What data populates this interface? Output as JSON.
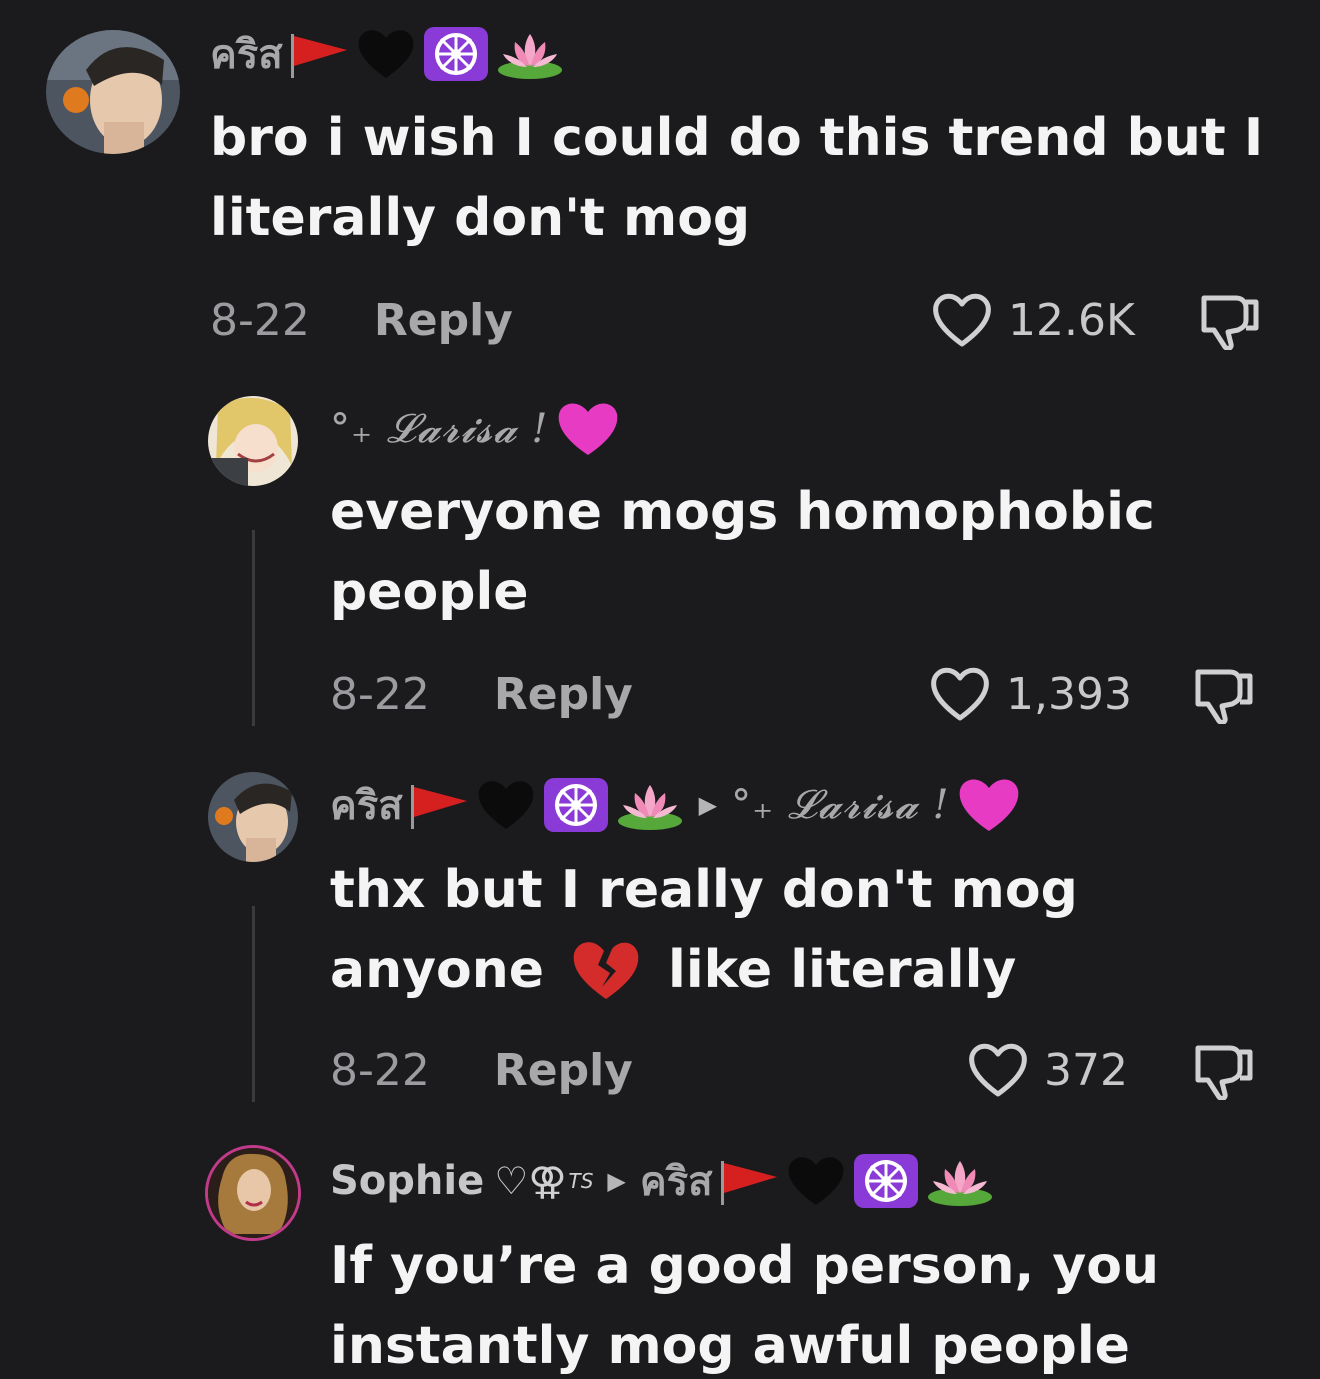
{
  "colors": {
    "background": "#1b1b1d",
    "text": "#f4f4f4",
    "muted": "#9c9ca0",
    "heart_pink": "#e83bc4",
    "wheel_purple": "#8a3ad6",
    "flag_red": "#d61f1f"
  },
  "icons": [
    "heart-outline-icon",
    "thumbs-down-icon",
    "red-flag-icon",
    "black-heart-icon",
    "dharma-wheel-icon",
    "lotus-icon",
    "pink-heart-icon",
    "broken-heart-icon",
    "triangle-right-icon"
  ],
  "comments": [
    {
      "author": "คริส",
      "text_lines": [
        "bro i wish I could do this trend but I",
        "literally don't mog"
      ],
      "date": "8-22",
      "reply_label": "Reply",
      "likes": "12.6K"
    },
    {
      "author": "°₊ 𝓛𝓪𝓻𝓲𝓼𝓪 !",
      "text_lines": [
        "everyone mogs homophobic",
        "people"
      ],
      "date": "8-22",
      "reply_label": "Reply",
      "likes": "1,393"
    },
    {
      "author": "คริส",
      "reply_to": "°₊ 𝓛𝓪𝓻𝓲𝓼𝓪 !",
      "text_line1": "thx but I really don't mog",
      "text_line2_a": "anyone",
      "text_line2_b": "like literally",
      "date": "8-22",
      "reply_label": "Reply",
      "likes": "372"
    },
    {
      "author": "Sophie",
      "author_symbols": "♡⚢",
      "author_sup": "TS",
      "reply_to": "คริส",
      "text_lines": [
        "If you’re a good person, you",
        "instantly mog awful people"
      ]
    }
  ]
}
